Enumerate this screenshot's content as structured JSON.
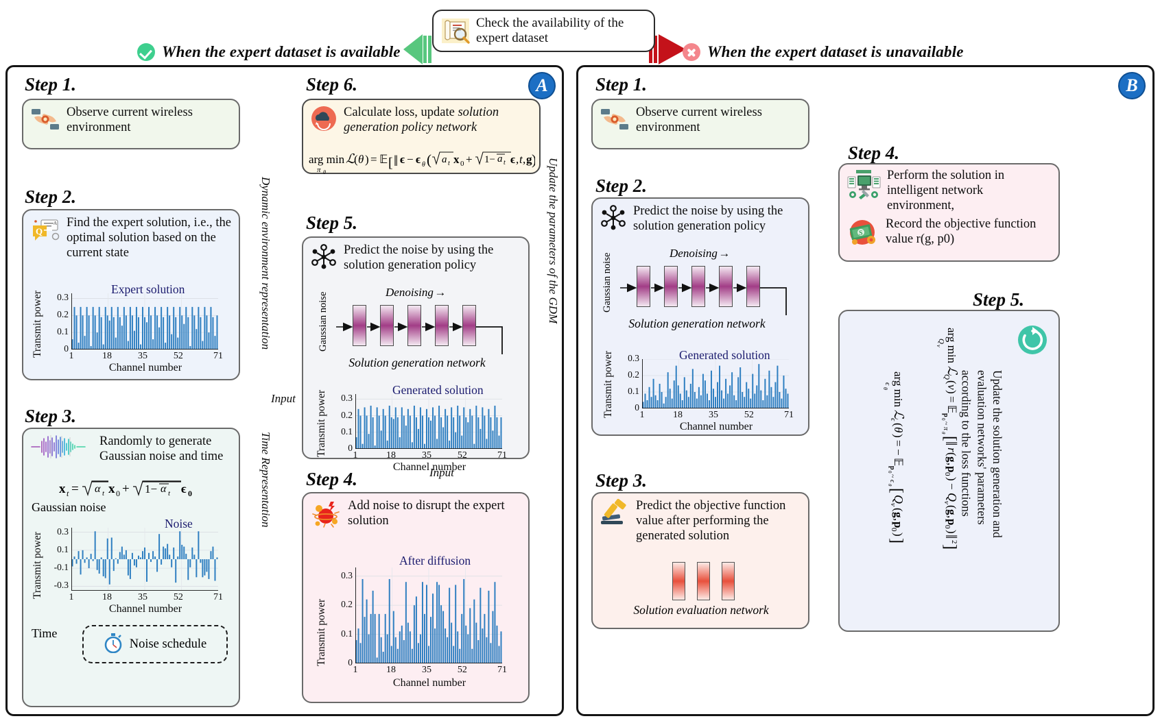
{
  "banner": {
    "check_text": "Check  the availability of the expert dataset",
    "check_icon": "scroll-magnifier-icon",
    "left_label": "When the expert dataset is available",
    "right_label": "When the expert dataset is unavailable",
    "left_badge_icon": "check-circle-icon",
    "right_badge_icon": "x-circle-icon",
    "left_arrow_icon": "arrow-left-green-icon",
    "right_arrow_icon": "arrow-right-red-icon"
  },
  "panel_a": {
    "letter": "A",
    "step1": {
      "label": "Step 1.",
      "icon": "handshake-observe-icon",
      "text": "Observe current wireless environment"
    },
    "step2": {
      "label": "Step 2.",
      "icon": "question-answer-icon",
      "text": "Find the expert solution, i.e., the optimal solution based on the current state"
    },
    "step3": {
      "label": "Step 3.",
      "icon": "waveform-icon",
      "text": "Randomly to generate Gaussian noise and time",
      "formula": "x_t = sqrt(alpha_bar_t) x_0 + sqrt(1 - alpha_bar_t) eps_0",
      "gaussian_noise_label": "Gaussian noise",
      "time_label": "Time",
      "noise_schedule_label": "Noise schedule",
      "noise_schedule_icon": "stopwatch-icon"
    },
    "step4": {
      "label": "Step 4.",
      "icon": "explosion-noise-icon",
      "text": "Add noise to disrupt the expert solution"
    },
    "step5": {
      "label": "Step 5.",
      "icon": "network-nodes-icon",
      "text": "Predict the noise by using the solution generation policy",
      "denoising_label": "Denoising",
      "gaussian_label": "Gaussian noise",
      "network_label": "Solution generation network"
    },
    "step6": {
      "label": "Step 6.",
      "icon": "cloud-refresh-icon",
      "text_plain": "Calculate loss, update ",
      "text_italic": "solution generation policy network",
      "formula": "argmin L(theta) = E[ || eps - eps_theta( sqrt(a_t) x_0 + sqrt(1 - a_bar_t) eps, t, g ) ||^2 ]"
    },
    "edge_labels": {
      "dynamic_env": "Dynamic environment representation",
      "time_repr": "Time Representation",
      "input_1": "Input",
      "input_2": "Input",
      "update_gdm": "Update the parameters of the GDM"
    }
  },
  "panel_b": {
    "letter": "B",
    "step1": {
      "label": "Step 1.",
      "icon": "handshake-observe-icon",
      "text": "Observe current wireless environment"
    },
    "step2": {
      "label": "Step 2.",
      "icon": "network-nodes-icon",
      "text": "Predict the noise by using the solution generation policy",
      "denoising_label": "Denoising",
      "gaussian_label": "Gaussian noise",
      "network_label": "Solution generation network"
    },
    "step3": {
      "label": "Step 3.",
      "icon": "gavel-icon",
      "text": "Predict the objective function value after performing  the generated solution",
      "network_label": "Solution evaluation network"
    },
    "step4": {
      "label": "Step 4.",
      "icon1": "server-gears-icon",
      "text1": "Perform the solution in intelligent network environment,",
      "icon2": "money-icon",
      "text2": "Record the objective function value r(g, p0)"
    },
    "step5": {
      "label": "Step 5.",
      "icon": "refresh-circle-icon",
      "text": "Update the solution generation and evaluation networks' parameters according to the loss functions",
      "formula_q": "argmin L_Q(v) = E_{p0~pi_theta}[ || r(g,p0) - Q_v(g,p0) ||^2 ]",
      "formula_e": "argmin L_e(theta) = -E_{p0~pi_theta}[ Q_v(g,p0) ]"
    }
  },
  "chart_data": [
    {
      "id": "expert-solution",
      "type": "bar",
      "title": "Expert solution",
      "xlabel": "Channel number",
      "ylabel": "Transmit power",
      "xticks": [
        1,
        18,
        35,
        52,
        71
      ],
      "yticks": [
        0,
        0.1,
        0.2,
        0.3
      ],
      "ylim": [
        0,
        0.33
      ],
      "xlim": [
        1,
        71
      ],
      "grid": true,
      "color": "#2f7fc1",
      "values": [
        0.06,
        0.25,
        0.2,
        0.04,
        0.25,
        0.2,
        0.08,
        0.25,
        0.2,
        0.02,
        0.25,
        0.2,
        0.1,
        0.25,
        0.19,
        0.03,
        0.25,
        0.2,
        0.17,
        0.25,
        0.19,
        0.07,
        0.25,
        0.19,
        0.14,
        0.25,
        0.2,
        0.05,
        0.25,
        0.2,
        0.11,
        0.25,
        0.19,
        0.03,
        0.25,
        0.19,
        0.16,
        0.25,
        0.2,
        0.06,
        0.25,
        0.2,
        0.13,
        0.25,
        0.19,
        0.04,
        0.25,
        0.2,
        0.09,
        0.25,
        0.19,
        0.07,
        0.25,
        0.2,
        0.15,
        0.25,
        0.19,
        0.02,
        0.25,
        0.2,
        0.12,
        0.25,
        0.19,
        0.05,
        0.25,
        0.2,
        0.1,
        0.25,
        0.19,
        0.08,
        0.2
      ]
    },
    {
      "id": "gaussian-noise",
      "type": "bar",
      "title": "Noise",
      "xlabel": "Channel number",
      "ylabel": "Transmit power",
      "xticks": [
        1,
        18,
        35,
        52,
        71
      ],
      "yticks": [
        -0.3,
        -0.1,
        0.1,
        0.3
      ],
      "ylim": [
        -0.35,
        0.35
      ],
      "xlim": [
        1,
        71
      ],
      "grid": true,
      "color": "#2f7fc1",
      "values": [
        -0.08,
        0.03,
        -0.05,
        0.09,
        -0.17,
        0.1,
        -0.04,
        0.02,
        -0.1,
        0.06,
        -0.02,
        0.31,
        -0.12,
        -0.16,
        0.02,
        -0.19,
        -0.21,
        0.23,
        -0.28,
        0.24,
        -0.13,
        0.01,
        -0.05,
        0.08,
        0.14,
        0.05,
        0.1,
        -0.18,
        -0.22,
        0.07,
        -0.07,
        -0.09,
        0.04,
        0.02,
        0.09,
        0.13,
        -0.25,
        0.07,
        -0.03,
        0.09,
        0.03,
        -0.14,
        0.28,
        -0.06,
        0.14,
        0.12,
        0.17,
        0.05,
        -0.09,
        0.13,
        -0.26,
        0.03,
        0.31,
        0.16,
        0.14,
        0.06,
        -0.23,
        -0.09,
        0.13,
        0.05,
        -0.2,
        0.31,
        -0.04,
        -0.2,
        -0.18,
        -0.14,
        -0.22,
        0.09,
        0.14,
        -0.24,
        0.02
      ]
    },
    {
      "id": "after-diffusion",
      "type": "bar",
      "title": "After diffusion",
      "xlabel": "Channel number",
      "ylabel": "Transmit power",
      "xticks": [
        1,
        18,
        35,
        52,
        71
      ],
      "yticks": [
        0,
        0.1,
        0.2,
        0.3
      ],
      "ylim": [
        0,
        0.33
      ],
      "xlim": [
        1,
        71
      ],
      "grid": true,
      "color": "#2f7fc1",
      "values": [
        0.08,
        0.12,
        0.07,
        0.29,
        0.16,
        0.22,
        0.1,
        0.17,
        0.25,
        0.17,
        0.02,
        0.17,
        0.09,
        0.04,
        0.17,
        0.1,
        0.29,
        0.06,
        0.18,
        0.09,
        0.05,
        0.11,
        0.13,
        0.08,
        0.28,
        0.14,
        0.11,
        0.05,
        0.2,
        0.23,
        0.07,
        0.1,
        0.28,
        0.17,
        0.27,
        0.06,
        0.16,
        0.24,
        0.12,
        0.28,
        0.27,
        0.2,
        0.18,
        0.12,
        0.09,
        0.26,
        0.14,
        0.06,
        0.27,
        0.11,
        0.05,
        0.17,
        0.29,
        0.13,
        0.1,
        0.19,
        0.05,
        0.22,
        0.14,
        0.08,
        0.26,
        0.12,
        0.17,
        0.09,
        0.25,
        0.07,
        0.18,
        0.28,
        0.13,
        0.06,
        0.11
      ]
    },
    {
      "id": "generated-solution-a",
      "type": "bar",
      "title": "Generated solution",
      "xlabel": "Channel number",
      "ylabel": "Transmit power",
      "xticks": [
        1,
        18,
        35,
        52,
        71
      ],
      "yticks": [
        0,
        0.1,
        0.2,
        0.3
      ],
      "ylim": [
        0,
        0.33
      ],
      "xlim": [
        1,
        71
      ],
      "grid": true,
      "color": "#2f7fc1",
      "values": [
        0.07,
        0.24,
        0.2,
        0.03,
        0.25,
        0.2,
        0.09,
        0.26,
        0.19,
        0.02,
        0.25,
        0.2,
        0.11,
        0.24,
        0.2,
        0.05,
        0.26,
        0.19,
        0.18,
        0.25,
        0.19,
        0.07,
        0.25,
        0.2,
        0.14,
        0.24,
        0.2,
        0.04,
        0.26,
        0.19,
        0.12,
        0.25,
        0.2,
        0.03,
        0.24,
        0.19,
        0.17,
        0.25,
        0.2,
        0.06,
        0.26,
        0.19,
        0.13,
        0.24,
        0.2,
        0.05,
        0.25,
        0.19,
        0.1,
        0.26,
        0.2,
        0.08,
        0.25,
        0.19,
        0.16,
        0.24,
        0.2,
        0.03,
        0.26,
        0.19,
        0.12,
        0.25,
        0.2,
        0.06,
        0.24,
        0.19,
        0.11,
        0.26,
        0.19,
        0.08,
        0.19
      ]
    },
    {
      "id": "generated-solution-b",
      "type": "bar",
      "title": "Generated solution",
      "xlabel": "Channel number",
      "ylabel": "Transmit power",
      "xticks": [
        1,
        18,
        35,
        52,
        71
      ],
      "yticks": [
        0,
        0.1,
        0.2,
        0.3
      ],
      "ylim": [
        0,
        0.3
      ],
      "xlim": [
        1,
        71
      ],
      "grid": true,
      "color": "#2f7fc1",
      "values": [
        0.04,
        0.09,
        0.05,
        0.13,
        0.07,
        0.18,
        0.08,
        0.05,
        0.15,
        0.1,
        0.03,
        0.07,
        0.22,
        0.12,
        0.06,
        0.17,
        0.26,
        0.14,
        0.09,
        0.05,
        0.19,
        0.11,
        0.07,
        0.15,
        0.24,
        0.1,
        0.06,
        0.13,
        0.08,
        0.21,
        0.17,
        0.09,
        0.05,
        0.23,
        0.12,
        0.07,
        0.16,
        0.26,
        0.11,
        0.06,
        0.18,
        0.09,
        0.14,
        0.22,
        0.08,
        0.05,
        0.19,
        0.25,
        0.1,
        0.07,
        0.16,
        0.12,
        0.06,
        0.21,
        0.09,
        0.14,
        0.27,
        0.11,
        0.05,
        0.18,
        0.08,
        0.23,
        0.13,
        0.07,
        0.16,
        0.26,
        0.1,
        0.06,
        0.2,
        0.12,
        0.09
      ]
    }
  ]
}
